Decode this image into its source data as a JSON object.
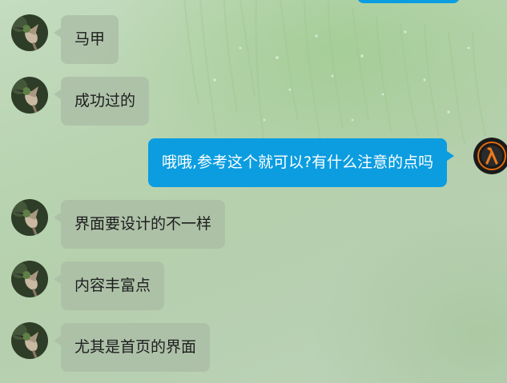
{
  "chat": {
    "messages": [
      {
        "direction": "incoming",
        "avatar": "hummingbird-avatar",
        "text": "马甲"
      },
      {
        "direction": "incoming",
        "avatar": "hummingbird-avatar",
        "text": "成功过的"
      },
      {
        "direction": "outgoing",
        "avatar": "half-life-lambda-avatar",
        "text": "哦哦,参考这个就可以?有什么注意的点吗"
      },
      {
        "direction": "incoming",
        "avatar": "hummingbird-avatar",
        "text": "界面要设计的不一样"
      },
      {
        "direction": "incoming",
        "avatar": "hummingbird-avatar",
        "text": "内容丰富点"
      },
      {
        "direction": "incoming",
        "avatar": "hummingbird-avatar",
        "text": "尤其是首页的界面"
      }
    ]
  },
  "colors": {
    "outgoing_bubble": "#0b9de0",
    "incoming_bubble": "#aabca5",
    "background": "#b7d3af"
  }
}
